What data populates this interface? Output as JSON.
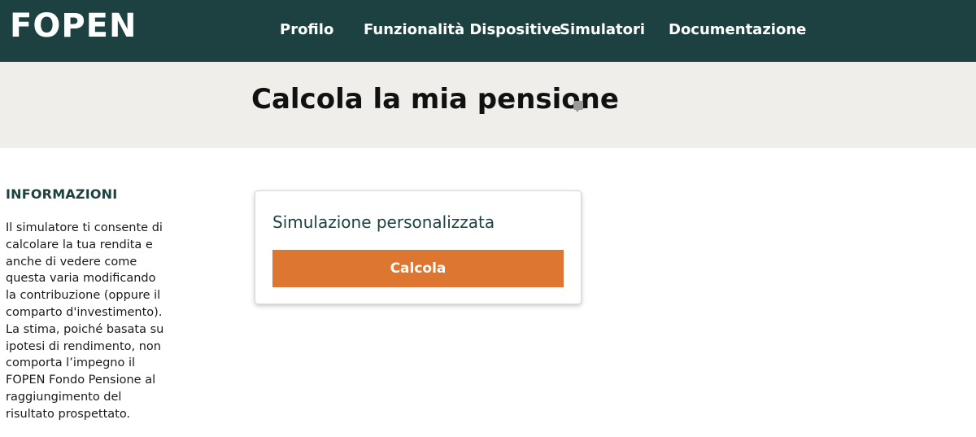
{
  "header": {
    "logo_text": "FOPEN",
    "nav": [
      {
        "label": "Profilo"
      },
      {
        "label": "Funzionalità Dispositive"
      },
      {
        "label": "Simulatori"
      },
      {
        "label": "Documentazione"
      }
    ],
    "background_color": "#1d4140"
  },
  "title_band": {
    "title": "Calcola la mia pensione",
    "icon": "comment-icon",
    "background_color": "#efeeea"
  },
  "sidebar": {
    "heading": "INFORMAZIONI",
    "text": "Il simulatore ti consente di calcolare la tua rendita e anche di vedere come questa varia modificando la contribuzione (oppure il comparto d'investimento). La stima, poiché basata su ipotesi di rendimento, non comporta l’impegno il FOPEN Fondo Pensione al raggiungimento del risultato prospettato."
  },
  "card": {
    "title": "Simulazione personalizzata",
    "button_label": "Calcola",
    "button_color": "#dc7630"
  }
}
